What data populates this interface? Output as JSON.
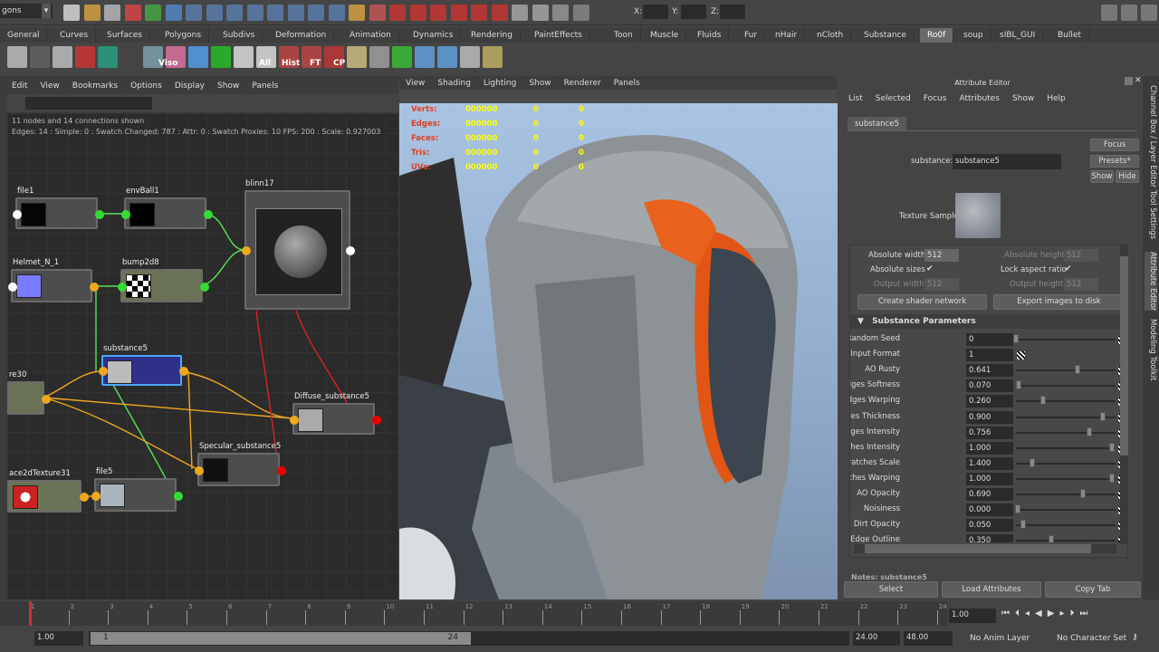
{
  "top_bar": {
    "mode_menu": "gons",
    "x_label": "X:",
    "y_label": "Y:",
    "z_label": "Z:"
  },
  "shelf": {
    "tabs": [
      "General",
      "Curves",
      "Surfaces",
      "Polygons",
      "Subdivs",
      "Deformation",
      "Animation",
      "Dynamics",
      "Rendering",
      "PaintEffects",
      "Toon",
      "Muscle",
      "Fluids",
      "Fur",
      "nHair",
      "nCloth",
      "Substance",
      "Ro0f",
      "soup",
      "sIBL_GUI",
      "Bullet"
    ],
    "active_tab": "Ro0f",
    "icon_labels": [
      "Viso",
      "All",
      "Hist",
      "FT",
      "CP"
    ]
  },
  "node_editor": {
    "menu": [
      "Edit",
      "View",
      "Bookmarks",
      "Options",
      "Display",
      "Show",
      "Panels"
    ],
    "info_line1": "11 nodes and 14 connections shown",
    "info_line2": "Edges: 14 : Simple: 0 : Swatch Changed: 787 : Attr: 0 : Swatch Proxies: 10 FPS: 200 : Scale: 0.927003",
    "nodes": {
      "file1": "file1",
      "envBall1": "envBall1",
      "blinn17": "blinn17",
      "helmet": "Helmet_N_1",
      "bump": "bump2d8",
      "substance": "substance5",
      "re30": "re30",
      "diffuse": "Diffuse_substance5",
      "specular": "Specular_substance5",
      "place2d": "ace2dTexture31",
      "file5": "file5"
    }
  },
  "viewport": {
    "menu": [
      "View",
      "Shading",
      "Lighting",
      "Show",
      "Renderer",
      "Panels"
    ],
    "stats": [
      {
        "label": "Verts:",
        "v1": "000000",
        "v2": "0",
        "v3": "0"
      },
      {
        "label": "Edges:",
        "v1": "000000",
        "v2": "0",
        "v3": "0"
      },
      {
        "label": "Faces:",
        "v1": "000000",
        "v2": "0",
        "v3": "0"
      },
      {
        "label": "Tris:",
        "v1": "000000",
        "v2": "0",
        "v3": "0"
      },
      {
        "label": "UVs:",
        "v1": "000000",
        "v2": "0",
        "v3": "0"
      }
    ]
  },
  "attribute_editor": {
    "title": "Attribute Editor",
    "menu": [
      "List",
      "Selected",
      "Focus",
      "Attributes",
      "Show",
      "Help"
    ],
    "tab": "substance5",
    "node_label": "substance:",
    "node_value": "substance5",
    "focus": "Focus",
    "presets": "Presets*",
    "show": "Show",
    "hide": "Hide",
    "texture_sample": "Texture Sample",
    "abs_width_label": "Absolute width",
    "abs_width": "512",
    "abs_height_label": "Absolute height",
    "abs_height": "512",
    "abs_sizes_label": "Absolute sizes",
    "lock_aspect_label": "Lock aspect ratio",
    "check": "✔",
    "out_width_label": "Output width",
    "out_width": "512",
    "out_height_label": "Output height",
    "out_height": "512",
    "create_shader": "Create shader network",
    "export_images": "Export images to disk",
    "section": "Substance Parameters",
    "params": [
      {
        "label": "Random Seed",
        "value": "0",
        "slider": 0.0
      },
      {
        "label": "Normal Input Format",
        "value": "1",
        "slider": null
      },
      {
        "label": "AO Rusty",
        "value": "0.641",
        "slider": 0.62
      },
      {
        "label": "Edges Softness",
        "value": "0.070",
        "slider": 0.03
      },
      {
        "label": "Edges Warping",
        "value": "0.260",
        "slider": 0.27
      },
      {
        "label": "Edges Thickness",
        "value": "0.900",
        "slider": 0.87
      },
      {
        "label": "Edges Intensity",
        "value": "0.756",
        "slider": 0.74
      },
      {
        "label": "Scratches Intensity",
        "value": "1.000",
        "slider": 0.96
      },
      {
        "label": "Scratches Scale",
        "value": "1.400",
        "slider": 0.16
      },
      {
        "label": "Scratches Warping",
        "value": "1.000",
        "slider": 0.96
      },
      {
        "label": "AO Opacity",
        "value": "0.690",
        "slider": 0.67
      },
      {
        "label": "Noisiness",
        "value": "0.000",
        "slider": 0.02
      },
      {
        "label": "Dirt Opacity",
        "value": "0.050",
        "slider": 0.07
      },
      {
        "label": "Edge Outline",
        "value": "0.350",
        "slider": 0.35
      }
    ],
    "notes_label": "Notes: substance5",
    "select": "Select",
    "load_attributes": "Load Attributes",
    "copy_tab": "Copy Tab"
  },
  "side_tabs": [
    "Channel Box / Layer Editor",
    "Tool Settings",
    "Attribute Editor",
    "Modeling Toolkit"
  ],
  "timeline": {
    "ticks": [
      "1",
      "2",
      "3",
      "4",
      "5",
      "6",
      "7",
      "8",
      "9",
      "10",
      "11",
      "12",
      "13",
      "14",
      "15",
      "16",
      "17",
      "18",
      "19",
      "20",
      "21",
      "22",
      "23",
      "24"
    ],
    "current_frame": "1.00",
    "range_start": "1.00",
    "range_inner_start": "1",
    "range_inner_end": "24",
    "range_end": "24.00",
    "anim_end": "48.00",
    "anim_layer": "No Anim Layer",
    "character_set": "No Character Set"
  }
}
